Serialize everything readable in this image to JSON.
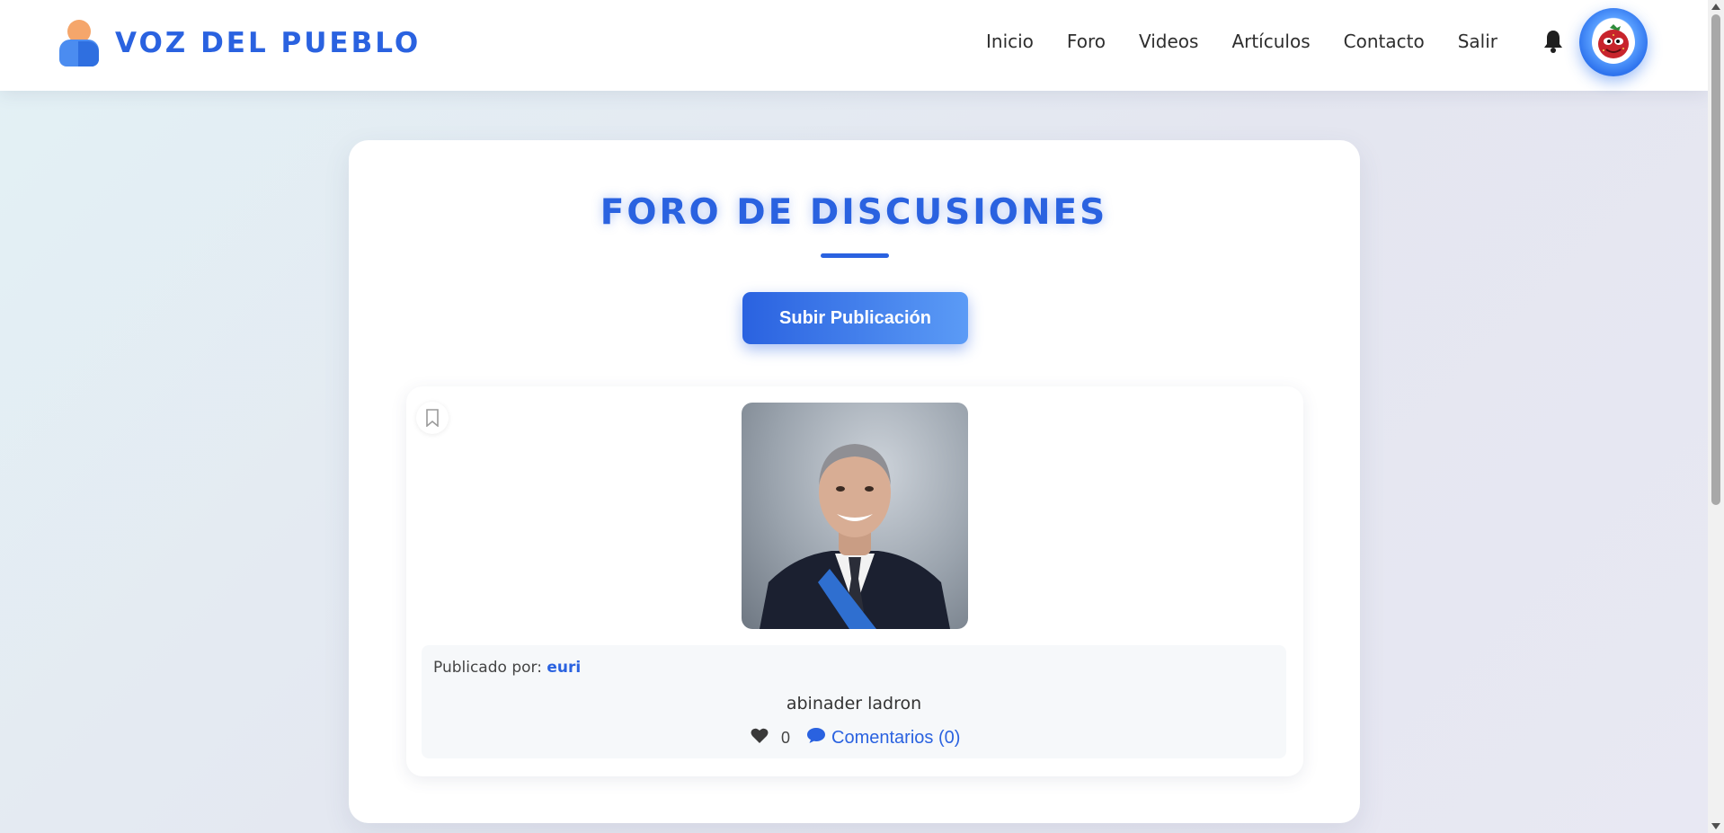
{
  "header": {
    "brand_name": "VOZ DEL PUEBLO",
    "nav": [
      "Inicio",
      "Foro",
      "Videos",
      "Artículos",
      "Contacto",
      "Salir"
    ]
  },
  "main": {
    "title": "FORO DE DISCUSIONES",
    "upload_button": "Subir Publicación"
  },
  "post": {
    "posted_by_label": "Publicado por:",
    "author": "euri",
    "text": "abinader ladron",
    "likes": "0",
    "comments_label": "Comentarios (0)"
  },
  "colors": {
    "accent": "#2a62e0",
    "accent_light": "#5b9bf6",
    "background": "#e4e6f0"
  },
  "icons": [
    "brand-user-icon",
    "bell-icon",
    "avatar-image",
    "bookmark-icon",
    "heart-icon",
    "comment-icon"
  ]
}
